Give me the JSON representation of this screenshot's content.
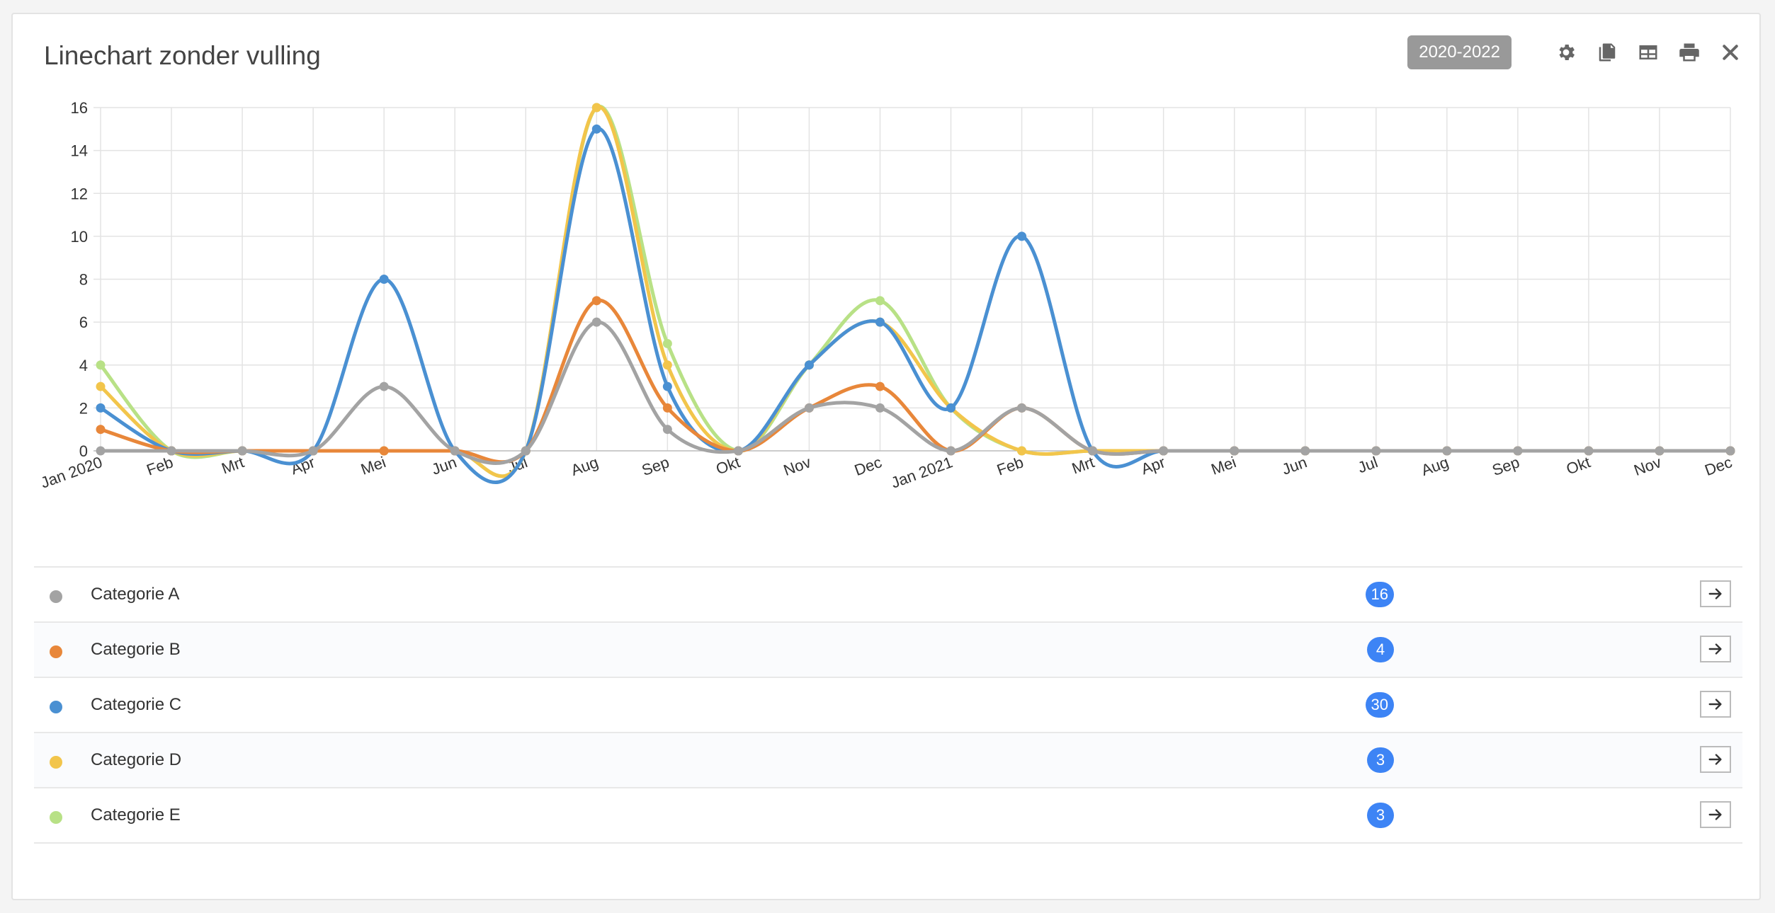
{
  "header": {
    "title": "Linechart zonder vulling",
    "range_badge": "2020-2022",
    "icons": [
      "gear-icon",
      "copy-icon",
      "table-icon",
      "print-icon",
      "close-icon"
    ]
  },
  "chart_data": {
    "type": "line",
    "categories": [
      "Jan 2020",
      "Feb",
      "Mrt",
      "Apr",
      "Mei",
      "Jun",
      "Jul",
      "Aug",
      "Sep",
      "Okt",
      "Nov",
      "Dec",
      "Jan 2021",
      "Feb",
      "Mrt",
      "Apr",
      "Mei",
      "Jun",
      "Jul",
      "Aug",
      "Sep",
      "Okt",
      "Nov",
      "Dec"
    ],
    "ylim": [
      0,
      16
    ],
    "yticks": [
      0,
      2,
      4,
      6,
      8,
      10,
      12,
      14,
      16
    ],
    "grid": true,
    "series": [
      {
        "name": "Categorie E",
        "color": "#b8e186",
        "values": [
          4,
          0,
          0,
          0,
          0,
          0,
          0,
          16,
          5,
          0,
          4,
          7,
          2,
          0,
          0,
          0,
          0,
          0,
          0,
          0,
          0,
          0,
          0,
          0
        ]
      },
      {
        "name": "Categorie D",
        "color": "#f2c54b",
        "values": [
          3,
          0,
          0,
          0,
          0,
          0,
          0,
          16,
          4,
          0,
          4,
          6,
          2,
          0,
          0,
          0,
          0,
          0,
          0,
          0,
          0,
          0,
          0,
          0
        ]
      },
      {
        "name": "Categorie C",
        "color": "#4a90d2",
        "values": [
          2,
          0,
          0,
          0,
          8,
          0,
          0,
          15,
          3,
          0,
          4,
          6,
          2,
          10,
          0,
          0,
          0,
          0,
          0,
          0,
          0,
          0,
          0,
          0
        ]
      },
      {
        "name": "Categorie B",
        "color": "#e8873a",
        "values": [
          1,
          0,
          0,
          0,
          0,
          0,
          0,
          7,
          2,
          0,
          2,
          3,
          0,
          2,
          0,
          0,
          0,
          0,
          0,
          0,
          0,
          0,
          0,
          0
        ]
      },
      {
        "name": "Categorie A",
        "color": "#a3a3a3",
        "values": [
          0,
          0,
          0,
          0,
          3,
          0,
          0,
          6,
          1,
          0,
          2,
          2,
          0,
          2,
          0,
          0,
          0,
          0,
          0,
          0,
          0,
          0,
          0,
          0
        ]
      }
    ]
  },
  "legend": {
    "items": [
      {
        "label": "Categorie A",
        "color": "#a3a3a3",
        "count": "16"
      },
      {
        "label": "Categorie B",
        "color": "#e8873a",
        "count": "4"
      },
      {
        "label": "Categorie C",
        "color": "#4a90d2",
        "count": "30"
      },
      {
        "label": "Categorie D",
        "color": "#f2c54b",
        "count": "3"
      },
      {
        "label": "Categorie E",
        "color": "#b8e186",
        "count": "3"
      }
    ]
  }
}
